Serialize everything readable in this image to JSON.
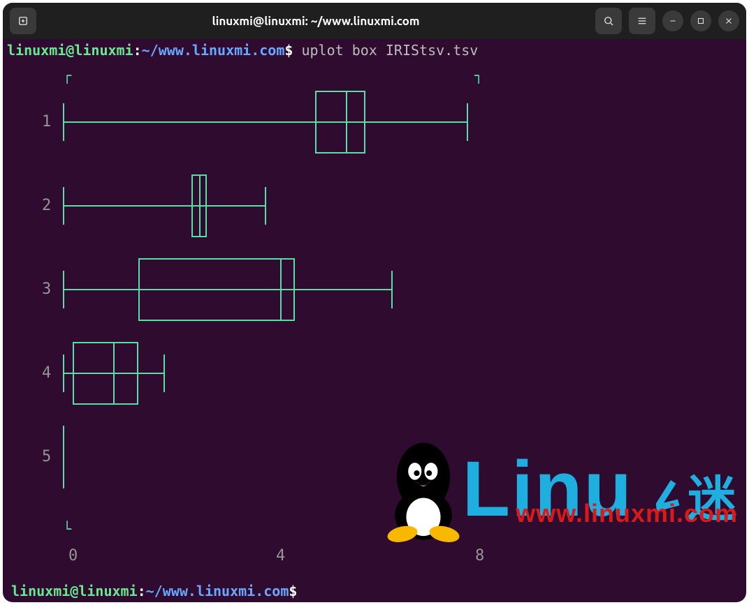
{
  "window": {
    "title": "linuxmi@linuxmi: ~/www.linuxmi.com"
  },
  "prompt": {
    "user": "linuxmi@linuxmi",
    "sep": ":",
    "path": "~/www.linuxmi.com",
    "dollar": "$",
    "command": "uplot box IRIStsv.tsv"
  },
  "chart_data": {
    "type": "box",
    "orientation": "horizontal",
    "xlabel": "",
    "ylabel": "",
    "xlim": [
      0,
      8.5
    ],
    "xticks": [
      0,
      4,
      8
    ],
    "categories": [
      "1",
      "2",
      "3",
      "4",
      "5"
    ],
    "series": [
      {
        "name": "1",
        "min": 0.0,
        "q1": 5.0,
        "median": 5.6,
        "q3": 6.0,
        "max": 8.0
      },
      {
        "name": "2",
        "min": 0.0,
        "q1": 2.55,
        "median": 2.7,
        "q3": 2.85,
        "max": 4.0
      },
      {
        "name": "3",
        "min": 0.0,
        "q1": 1.5,
        "median": 4.3,
        "q3": 4.6,
        "max": 6.5
      },
      {
        "name": "4",
        "min": 0.0,
        "q1": 0.2,
        "median": 1.0,
        "q3": 1.5,
        "max": 2.0
      },
      {
        "name": "5",
        "min": 0.0,
        "q1": 0.0,
        "median": 0.0,
        "q3": 0.0,
        "max": 0.0
      }
    ],
    "axis_corners": {
      "tl": "┌",
      "tr": "┐",
      "bl": "└"
    },
    "plot_color": "#57dfa6"
  },
  "watermark": {
    "brand_prefix": "Linu",
    "brand_suffix": "迷",
    "url": "www.linuxmi.com"
  },
  "icons": {
    "new_tab": "new-tab-icon",
    "search": "search-icon",
    "menu": "hamburger-icon",
    "minimize": "minimize-icon",
    "maximize": "maximize-icon",
    "close": "close-icon"
  }
}
